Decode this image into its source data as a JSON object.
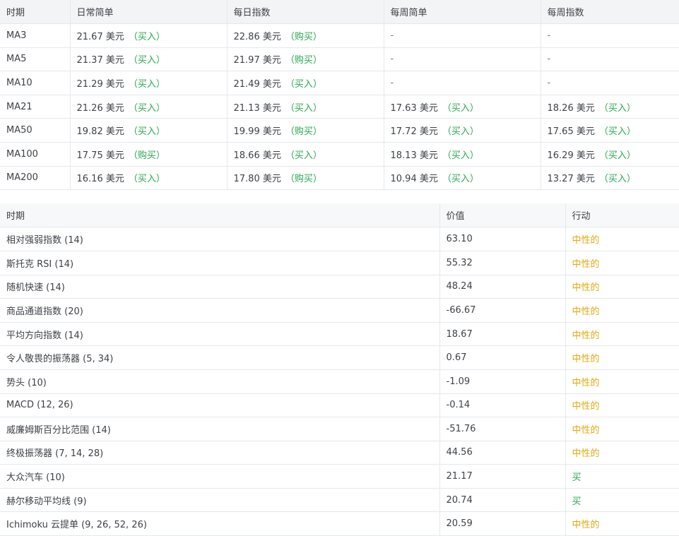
{
  "ma_table": {
    "headers": [
      "时期",
      "日常简单",
      "每日指数",
      "每周简单",
      "每周指数"
    ],
    "rows": [
      {
        "period": "MA3",
        "cells": [
          {
            "value": "21.67 美元",
            "signal": "（买入）"
          },
          {
            "value": "22.86 美元",
            "signal": "（购买）"
          },
          {
            "value": "-",
            "signal": ""
          },
          {
            "value": "-",
            "signal": ""
          }
        ]
      },
      {
        "period": "MA5",
        "cells": [
          {
            "value": "21.37 美元",
            "signal": "（买入）"
          },
          {
            "value": "21.97 美元",
            "signal": "（购买）"
          },
          {
            "value": "-",
            "signal": ""
          },
          {
            "value": "-",
            "signal": ""
          }
        ]
      },
      {
        "period": "MA10",
        "cells": [
          {
            "value": "21.29 美元",
            "signal": "（买入）"
          },
          {
            "value": "21.49 美元",
            "signal": "（买入）"
          },
          {
            "value": "-",
            "signal": ""
          },
          {
            "value": "-",
            "signal": ""
          }
        ]
      },
      {
        "period": "MA21",
        "cells": [
          {
            "value": "21.26 美元",
            "signal": "（买入）"
          },
          {
            "value": "21.13 美元",
            "signal": "（买入）"
          },
          {
            "value": "17.63 美元",
            "signal": "（买入）"
          },
          {
            "value": "18.26 美元",
            "signal": "（买入）"
          }
        ]
      },
      {
        "period": "MA50",
        "cells": [
          {
            "value": "19.82 美元",
            "signal": "（买入）"
          },
          {
            "value": "19.99 美元",
            "signal": "（购买）"
          },
          {
            "value": "17.72 美元",
            "signal": "（买入）"
          },
          {
            "value": "17.65 美元",
            "signal": "（买入）"
          }
        ]
      },
      {
        "period": "MA100",
        "cells": [
          {
            "value": "17.75 美元",
            "signal": "（购买）"
          },
          {
            "value": "18.66 美元",
            "signal": "（买入）"
          },
          {
            "value": "18.13 美元",
            "signal": "（买入）"
          },
          {
            "value": "16.29 美元",
            "signal": "（买入）"
          }
        ]
      },
      {
        "period": "MA200",
        "cells": [
          {
            "value": "16.16 美元",
            "signal": "（买入）"
          },
          {
            "value": "17.80 美元",
            "signal": "（购买）"
          },
          {
            "value": "10.94 美元",
            "signal": "（买入）"
          },
          {
            "value": "13.27 美元",
            "signal": "（买入）"
          }
        ]
      }
    ]
  },
  "oscillator_table": {
    "headers": [
      "时期",
      "价值",
      "行动"
    ],
    "rows": [
      {
        "name": "相对强弱指数 (14)",
        "value": "63.10",
        "action": "中性的",
        "status": "neutral"
      },
      {
        "name": "斯托克 RSI (14)",
        "value": "55.32",
        "action": "中性的",
        "status": "neutral"
      },
      {
        "name": "随机快速 (14)",
        "value": "48.24",
        "action": "中性的",
        "status": "neutral"
      },
      {
        "name": "商品通道指数 (20)",
        "value": "-66.67",
        "action": "中性的",
        "status": "neutral"
      },
      {
        "name": "平均方向指数 (14)",
        "value": "18.67",
        "action": "中性的",
        "status": "neutral"
      },
      {
        "name": "令人敬畏的振荡器 (5, 34)",
        "value": "0.67",
        "action": "中性的",
        "status": "neutral"
      },
      {
        "name": "势头 (10)",
        "value": "-1.09",
        "action": "中性的",
        "status": "neutral"
      },
      {
        "name": "MACD (12, 26)",
        "value": "-0.14",
        "action": "中性的",
        "status": "neutral"
      },
      {
        "name": "威廉姆斯百分比范围 (14)",
        "value": "-51.76",
        "action": "中性的",
        "status": "neutral"
      },
      {
        "name": "终极振荡器 (7, 14, 28)",
        "value": "44.56",
        "action": "中性的",
        "status": "neutral"
      },
      {
        "name": "大众汽车 (10)",
        "value": "21.17",
        "action": "买",
        "status": "buy"
      },
      {
        "name": "赫尔移动平均线 (9)",
        "value": "20.74",
        "action": "买",
        "status": "buy"
      },
      {
        "name": "Ichimoku 云提单 (9, 26, 52, 26)",
        "value": "20.59",
        "action": "中性的",
        "status": "neutral"
      }
    ]
  },
  "colors": {
    "buy": "#27a94e",
    "neutral": "#e0a80f",
    "header_bg": "#f3f4f6",
    "border": "#e6e8ec",
    "text": "#3d4147"
  }
}
